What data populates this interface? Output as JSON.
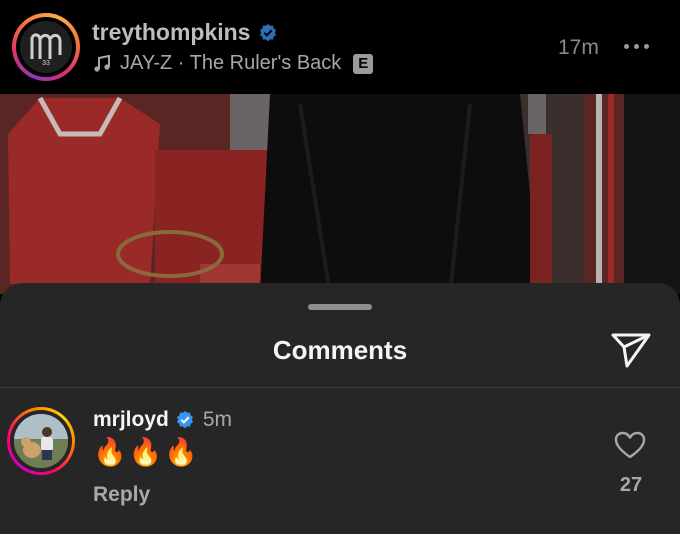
{
  "post": {
    "username": "treythompkins",
    "music": "JAY-Z · The Ruler's Back",
    "explicit_badge": "E",
    "time_ago": "17m",
    "avatar_mark": "33"
  },
  "comments_sheet": {
    "title": "Comments",
    "comments": [
      {
        "username": "mrjloyd",
        "time_ago": "5m",
        "text": "🔥🔥🔥",
        "reply_label": "Reply",
        "likes": "27"
      }
    ]
  },
  "colors": {
    "sheet_bg": "#262626",
    "verified": "#3797f0"
  }
}
